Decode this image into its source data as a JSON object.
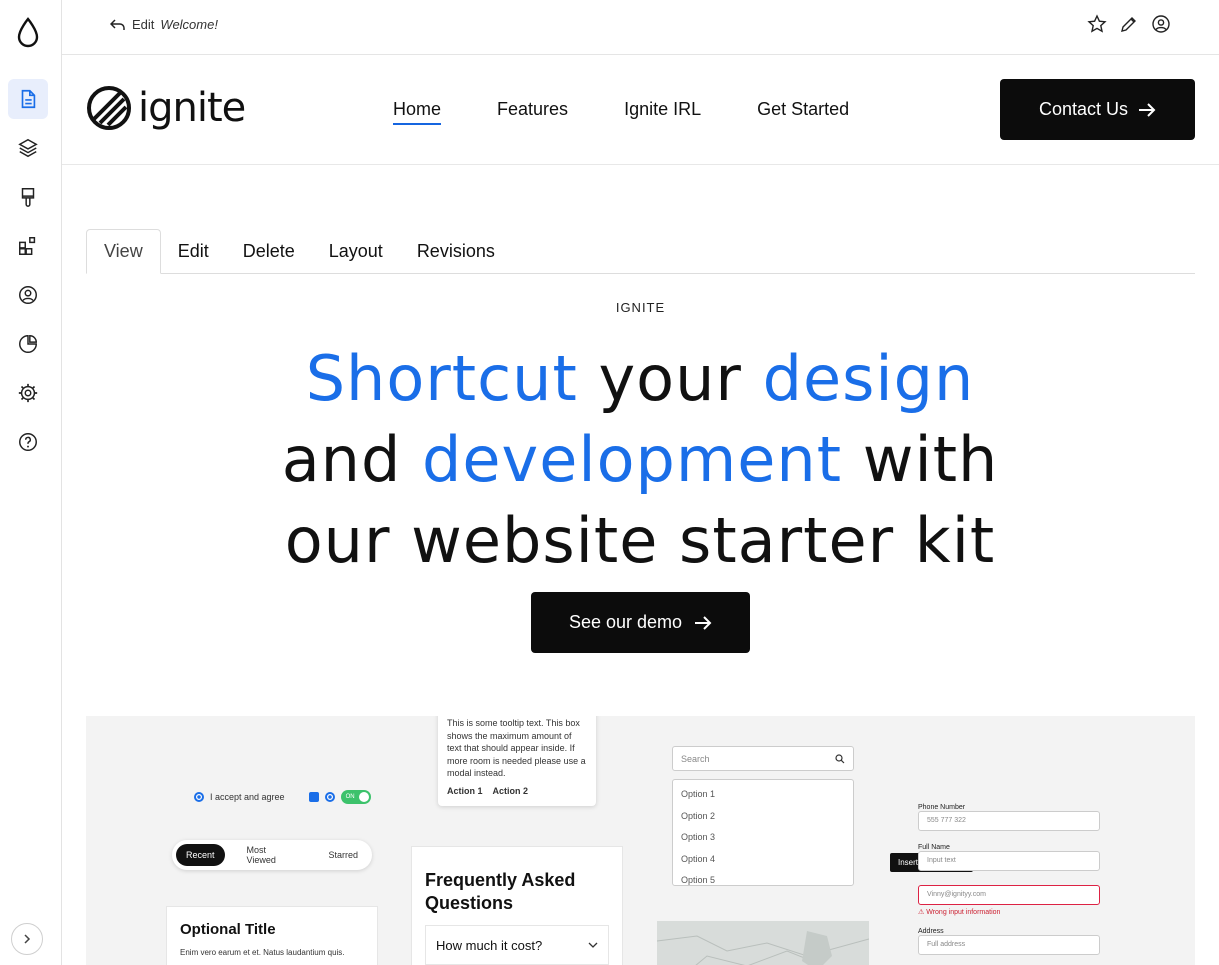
{
  "editbar": {
    "back_prefix": "Edit",
    "back_page": "Welcome!"
  },
  "header": {
    "brand": "ignite",
    "nav": [
      "Home",
      "Features",
      "Ignite IRL",
      "Get Started"
    ],
    "contact_label": "Contact Us"
  },
  "tabs": [
    "View",
    "Edit",
    "Delete",
    "Layout",
    "Revisions"
  ],
  "hero": {
    "eyebrow": "IGNITE",
    "line1_a": "Shortcut",
    "line1_b": " your ",
    "line1_c": "design",
    "line2_a": "and ",
    "line2_b": "development",
    "line2_c": " with",
    "line3": "our website starter kit",
    "cta": "See our demo"
  },
  "showcase": {
    "tooltip_text": "This is some tooltip text. This box shows the maximum amount of text that should appear inside. If more room is needed please use a modal instead.",
    "tooltip_action1": "Action 1",
    "tooltip_action2": "Action 2",
    "accept_label": "I accept and agree",
    "toggle_label": "ON",
    "pills": [
      "Recent",
      "Most Viewed",
      "Starred"
    ],
    "optional_title": "Optional Title",
    "optional_desc": "Enim vero earum et et. Natus laudantium quis.",
    "faq_title": "Frequently Asked Questions",
    "faq_q1": "How much it cost?",
    "search_placeholder": "Search",
    "options": [
      "Option 1",
      "Option 2",
      "Option 3",
      "Option 4",
      "Option 5"
    ],
    "phone_label": "Phone Number",
    "phone_value": "555 777 322",
    "fullname_label": "Full Name",
    "fullname_placeholder": "Input text",
    "email_tooltip": "Insert a valid email",
    "email_value": "Vinny@ignityy.com",
    "email_error": "⚠ Wrong input information",
    "address_label": "Address",
    "address_placeholder": "Full address"
  },
  "colors": {
    "accent": "#1a6ee8",
    "button_bg": "#0c0c0c",
    "rail_active_bg": "#e8eefc"
  }
}
